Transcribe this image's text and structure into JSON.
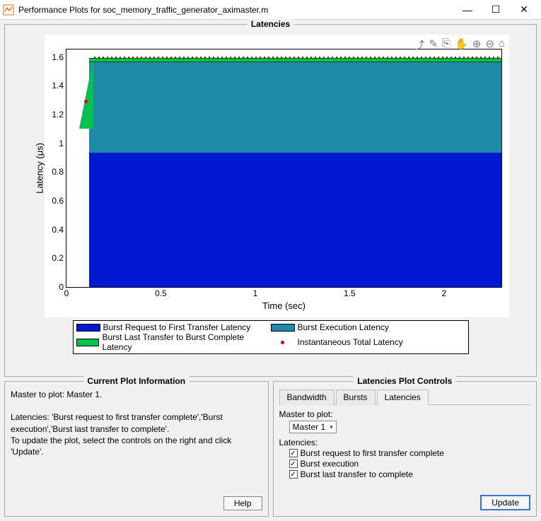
{
  "window": {
    "title": "Performance Plots for soc_memory_traffic_generator_aximaster.m"
  },
  "chart_data": {
    "type": "area",
    "title": "Latencies",
    "xlabel": "Time (sec)",
    "ylabel": "Latency (μs)",
    "xlim": [
      0,
      2.3
    ],
    "ylim": [
      0,
      1.65
    ],
    "xticks": [
      0,
      0.5,
      1,
      1.5,
      2
    ],
    "yticks": [
      0,
      0.2,
      0.4,
      0.6,
      0.8,
      1,
      1.2,
      1.4,
      1.6
    ],
    "series": [
      {
        "name": "Burst Request to First Transfer Latency",
        "color": "#0018d2",
        "x": [
          0.12,
          0.18,
          2.3
        ],
        "y": [
          0,
          0.93,
          0.93
        ]
      },
      {
        "name": "Burst Execution Latency",
        "color": "#1e8aa8",
        "x": [
          0.12,
          0.18,
          2.3
        ],
        "y": [
          0,
          1.56,
          1.56
        ]
      },
      {
        "name": "Burst Last Transfer to Burst Complete Latency",
        "color": "#00c050",
        "x": [
          0.12,
          0.18,
          2.3
        ],
        "y": [
          0,
          1.59,
          1.59
        ]
      },
      {
        "name": "Instantaneous Total Latency",
        "color": "#d00000",
        "style": "dots",
        "x": [
          0.12,
          0.18,
          2.3
        ],
        "y": [
          1.3,
          1.59,
          1.59
        ]
      }
    ],
    "legend": [
      "Burst Request to First Transfer Latency",
      "Burst Execution Latency",
      "Burst Last Transfer to Burst Complete Latency",
      "Instantaneous Total Latency"
    ]
  },
  "info_panel": {
    "title": "Current Plot Information",
    "line1": "Master to plot: Master 1.",
    "line2": "Latencies: 'Burst request to first transfer complete','Burst execution','Burst last transfer to complete'.",
    "line3": "To update the plot, select the controls on the right and click 'Update'.",
    "help_label": "Help"
  },
  "controls_panel": {
    "title": "Latencies Plot Controls",
    "tabs": [
      "Bandwidth",
      "Bursts",
      "Latencies"
    ],
    "active_tab": "Latencies",
    "master_label": "Master to plot:",
    "master_value": "Master 1",
    "latencies_label": "Latencies:",
    "checks": [
      "Burst request to first transfer complete",
      "Burst execution",
      "Burst last transfer to complete"
    ],
    "update_label": "Update"
  },
  "toolbar_icons": [
    "share-icon",
    "brush-icon",
    "data-tips-icon",
    "pan-icon",
    "zoom-in-icon",
    "zoom-out-icon",
    "home-icon"
  ]
}
